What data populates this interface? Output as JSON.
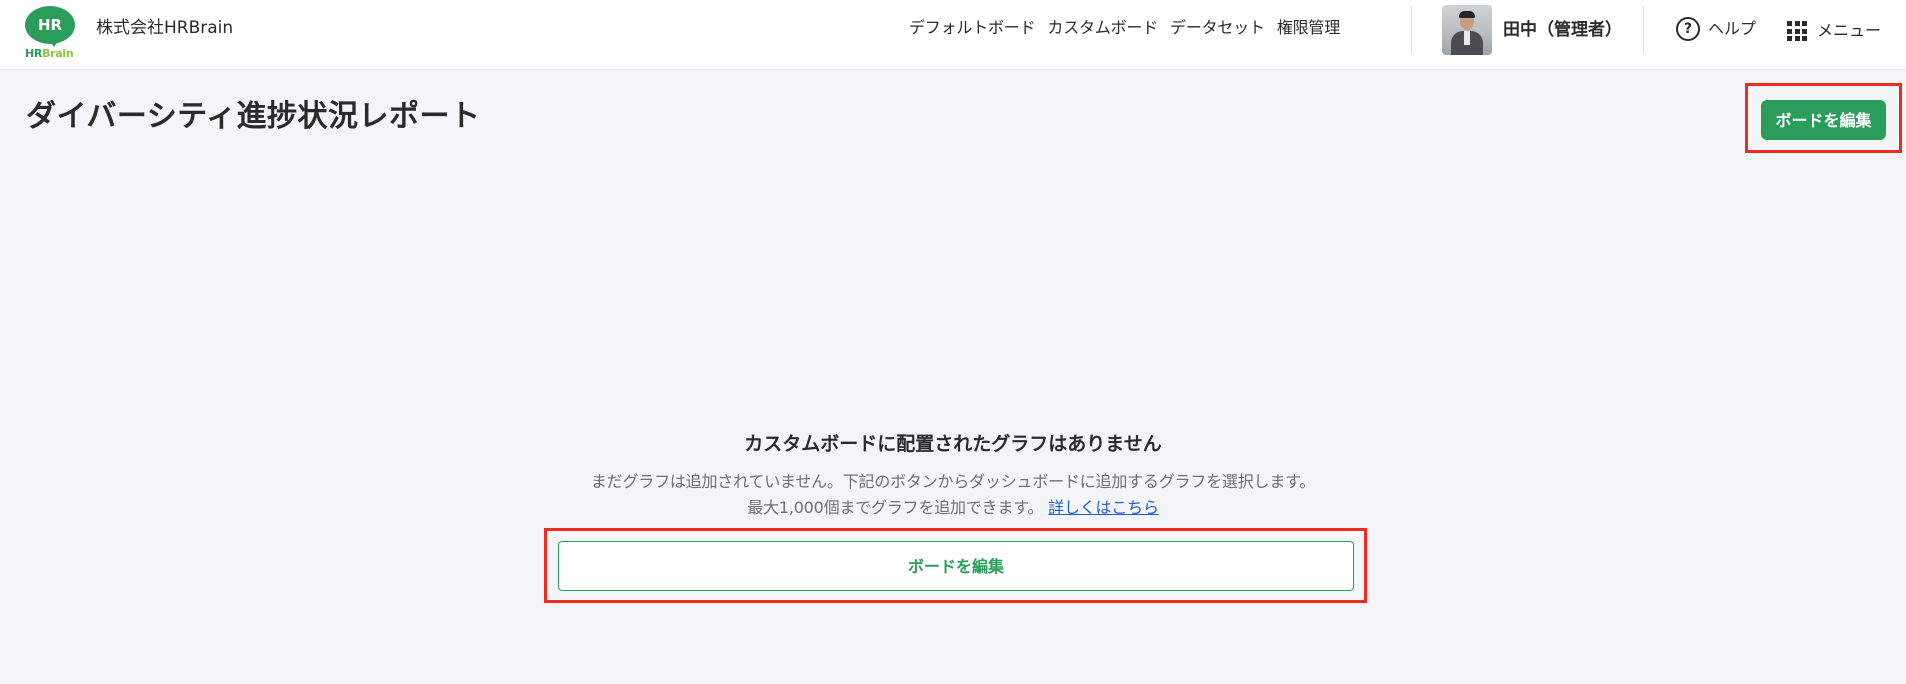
{
  "header": {
    "logo": {
      "badge_text": "HR",
      "word_hr": "HR",
      "word_brain": "Brain"
    },
    "company_name": "株式会社HRBrain",
    "nav": [
      {
        "label": "デフォルトボード"
      },
      {
        "label": "カスタムボード"
      },
      {
        "label": "データセット"
      },
      {
        "label": "権限管理"
      }
    ],
    "user": {
      "name": "田中（管理者）"
    },
    "help": {
      "icon_name": "question-circle-icon",
      "glyph": "?",
      "label": "ヘルプ"
    },
    "menu": {
      "icon_name": "grid-icon",
      "label": "メニュー"
    }
  },
  "page": {
    "title": "ダイバーシティ進捗状況レポート",
    "edit_button_label": "ボードを編集"
  },
  "empty_state": {
    "heading": "カスタムボードに配置されたグラフはありません",
    "description_line1": "まだグラフは追加されていません。下記のボタンからダッシュボードに追加するグラフを選択します。",
    "description_line2": "最大1,000個までグラフを追加できます。",
    "link_text": "詳しくはこちら",
    "button_label": "ボードを編集"
  },
  "colors": {
    "brand_green": "#2a9d5a",
    "brand_light_green": "#8cc63f",
    "highlight_red": "#ee2b1e",
    "link_blue": "#1f5fd1",
    "background": "#f4f5f8"
  }
}
